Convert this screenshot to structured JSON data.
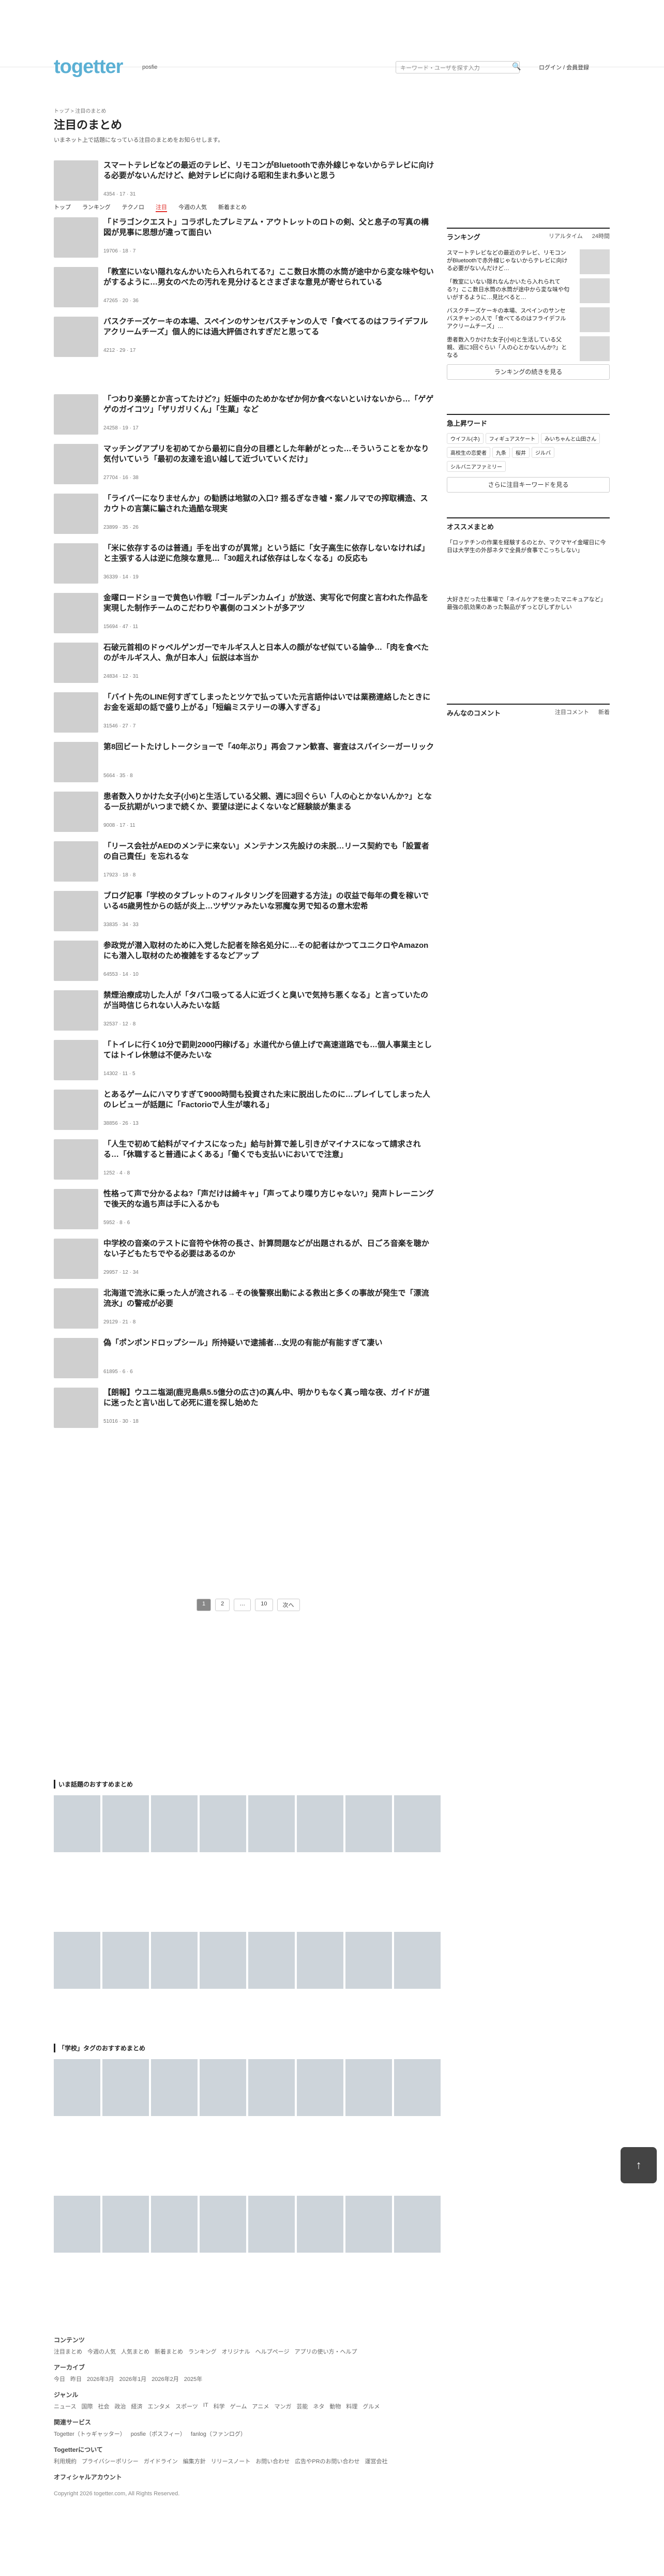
{
  "header": {
    "logo": "togetter",
    "logo_sub": "posfie",
    "search_placeholder": "キーワード・ユーザを探す入力",
    "login": "ログイン / 会員登録"
  },
  "breadcrumb": "トップ > 注目のまとめ",
  "page": {
    "title": "注目のまとめ",
    "desc": "いまネット上で話題になっている注目のまとめをお知らせします。"
  },
  "tabs": [
    "トップ",
    "ランキング",
    "テクノロ",
    "注目",
    "今週の人気",
    "新着まとめ"
  ],
  "tab_active": 3,
  "items": [
    {
      "title": "スマートテレビなどの最近のテレビ、リモコンがBluetoothで赤外線じゃないからテレビに向ける必要がないんだけど、絶対テレビに向ける昭和生まれ多いと思う",
      "meta": "4354 · 17 · 31"
    },
    {
      "title": "「ドラゴンクエスト」コラボしたプレミアム・アウトレットのロトの剣、父と息子の写真の構図が見事に思想が違って面白い",
      "meta": "19706 · 18 · 7"
    },
    {
      "title": "「教室にいない隠れなんかいたら入れられてる?」ここ数日水筒の水筒が途中から変な味や匂いがするように…男女のべたの汚れを見分けるとさまざまな意見が寄せられている",
      "meta": "47265 · 20 · 36"
    },
    {
      "title": "バスクチーズケーキの本場、スペインのサンセバスチャンの人で「食べてるのはフライデフルアクリームチーズ」個人的には過大評価されすぎだと思ってる",
      "meta": "4212 · 29 · 17"
    },
    {
      "title": "「つわり楽勝とか言ってたけど?」妊娠中のためかなぜか何か食べないといけないから…「ゲゲゲのガイコツ」「ザリガリくん」「生菓」など",
      "meta": "24258 · 19 · 17"
    },
    {
      "title": "マッチングアプリを初めてから最初に自分の目標とした年齢がとった…そういうことをかなり気付いていう「最初の友達を追い越して近づいていくだけ」",
      "meta": "27704 · 16 · 38"
    },
    {
      "title": "「ライバーになりませんか」の勧誘は地獄の入口? 揺るぎなき嘘・案ノルマでの搾取構造、スカウトの言葉に騙された過酷な現実",
      "meta": "23899 · 35 · 26"
    },
    {
      "title": "「米に依存するのは普通」手を出すのが異常」という話に「女子高生に依存しないなければ」と主張する人は逆に危険な意見…「30超えれば依存はしなくなる」の反応も",
      "meta": "36339 · 14 · 19"
    },
    {
      "title": "金曜ロードショーで黄色い作戦「ゴールデンカムイ」が放送、実写化で何度と言われた作品を実現した制作チームのこだわりや裏側のコメントが多アツ",
      "meta": "15694 · 47 · 11"
    },
    {
      "title": "石破元首相のドゥペルゲンガーでキルギス人と日本人の顔がなぜ似ている論争…「肉を食べたのがキルギス人、魚が日本人」伝説は本当か",
      "meta": "24834 · 12 · 31"
    },
    {
      "title": "「バイト先のLINE何すぎてしまったとツケで払っていた元言語仲はいでは業務連絡したときにお金を返却の話で盛り上がる」「短編ミステリーの導入すぎる」",
      "meta": "31546 · 27 · 7"
    },
    {
      "title": "第8回ビートたけしトークショーで「40年ぶり」再会ファン歓喜、審査はスパイシーガーリック",
      "meta": "5664 · 35 · 8"
    },
    {
      "title": "患者数入りかけた女子(小6)と生活している父親、週に3回ぐらい「人の心とかないんか?」となる一反抗期がいつまで続くか、要望は逆によくないなど経験談が集まる",
      "meta": "9008 · 17 · 11"
    },
    {
      "title": "「リース会社がAEDのメンテに来ない」メンテナンス先設けの未脱…リース契約でも「設置者の自己責任」を忘れるな",
      "meta": "17923 · 18 · 8"
    },
    {
      "title": "ブログ記事「学校のタブレットのフィルタリングを回避する方法」の収益で毎年の費を稼いでいる45歳男性からの話が炎上…ツザツァみたいな邪魔な男で知るの意木宏希",
      "meta": "33835 · 34 · 33"
    },
    {
      "title": "参政党が潜入取材のために入党した記者を除名処分に…その記者はかつてユニクロやAmazonにも潜入し取材のため複雑をするなどアップ",
      "meta": "64553 · 14 · 10"
    },
    {
      "title": "禁煙治療成功した人が「タバコ吸ってる人に近づくと臭いで気持ち悪くなる」と言っていたのが当時信じられない人みたいな話",
      "meta": "32537 · 12 · 8"
    },
    {
      "title": "「トイレに行く10分で罰則2000円稼げる」水道代から値上げで高速道路でも…個人事業主としてはトイレ休憩は不便みたいな",
      "meta": "14302 · 11 · 5"
    },
    {
      "title": "とあるゲームにハマりすぎて9000時間も投資された末に脱出したのに…プレイしてしまった人のレビューが話題に「Factorioで人生が壊れる」",
      "meta": "38856 · 26 · 13"
    },
    {
      "title": "「人生で初めて給料がマイナスになった」給与計算で差し引きがマイナスになって請求される…「休職すると普通によくある」「働くでも支払いにおいてで注意」",
      "meta": "1252 · 4 · 8"
    },
    {
      "title": "性格って声で分かるよね?「声だけは綺キャ」「声ってより喋り方じゃない?」発声トレーニングで後天的な過ち声は手に入るかも",
      "meta": "5952 · 8 · 6"
    },
    {
      "title": "中学校の音楽のテストに音符や休符の長さ、計算問題などが出題されるが、日ごろ音楽を聴かない子どもたちでやる必要はあるのか",
      "meta": "29957 · 12 · 34"
    },
    {
      "title": "北海道で流氷に乗った人が流される→その後警察出動による救出と多くの事故が発生で「漂流流氷」の警戒が必要",
      "meta": "29129 · 21 · 8"
    },
    {
      "title": "偽「ポンポンドロップシール」所持疑いで逮捕者…女児の有能が有能すぎて凄い",
      "meta": "61895 · 6 · 6"
    },
    {
      "title": "【朗報】ウユニ塩湖(鹿児島県5.5億分の広さ)の真ん中、明かりもなく真っ暗な夜、ガイドが道に迷ったと言い出して必死に道を探し始めた",
      "meta": "51016 · 30 · 18"
    }
  ],
  "sidebar": {
    "ranking_title": "ランキング",
    "ranking_tabs": [
      "リアルタイム",
      "24時間"
    ],
    "ranking_items": [
      "スマートテレビなどの最近のテレビ、リモコンがBluetoothで赤外線じゃないからテレビに向ける必要がないんだけど…",
      "「教室にいない隠れなんかいたら入れられてる?」ここ数日水筒の水筒が途中から変な味や匂いがするように…見比べると…",
      "バスクチーズケーキの本場、スペインのサンセバスチャンの人で「食べてるのはフライデフルアクリームチーズ」…",
      "患者数入りかけた女子(小6)と生活している父親、週に3回ぐらい「人の心とかないんか?」となる"
    ],
    "ranking_more": "ランキングの続きを見る",
    "keywords_title": "急上昇ワード",
    "keywords": [
      "ウイフル(ネ)",
      "フィギュアスケート",
      "みいちゃんと山田さん",
      "高校生の恋愛者",
      "九条",
      "桜井",
      "ジルバ",
      "シルバニアファミリー"
    ],
    "keywords_more": "さらに注目キーワードを見る",
    "osusume_title": "オススメまとめ",
    "osusume_items": [
      "「ロッテチンの作業を経験するのとか、マクマヤイ金曜日に今日は大学生の外部ネタで全員が食事でこっちしない」",
      "大好きだった仕事場で「ネイルケアを使ったマニキュアなど」最強の肌効果のあった製品がずっとびしずかしい"
    ],
    "comments_title": "みんなのコメント",
    "comments_tabs": [
      "注目コメント",
      "新着"
    ]
  },
  "pagination": [
    "1",
    "2",
    "…",
    "10",
    "次へ"
  ],
  "reco_sections": [
    {
      "title": "いま話題のおすすめまとめ"
    },
    {
      "title": "「学校」タグのおすすめまとめ"
    }
  ],
  "footer": {
    "contents_h": "コンテンツ",
    "contents": [
      "注目まとめ",
      "今週の人気",
      "人気まとめ",
      "新着まとめ",
      "ランキング",
      "オリジナル",
      "ヘルプページ",
      "アプリの使い方・ヘルプ"
    ],
    "archive_h": "アーカイブ",
    "archive": [
      "今日",
      "昨日",
      "2026年3月",
      "2026年1月",
      "2026年2月",
      "2025年"
    ],
    "genre_h": "ジャンル",
    "genre": [
      "ニュース",
      "国際",
      "社会",
      "政治",
      "経済",
      "エンタメ",
      "スポーツ",
      "IT",
      "科学",
      "ゲーム",
      "アニメ",
      "マンガ",
      "芸能",
      "ネタ",
      "動物",
      "料理",
      "グルメ"
    ],
    "service_h": "関連サービス",
    "service": [
      "Togetter（トゥギャッター）",
      "posfie（ポスフィー）",
      "fanlog（ファンログ）"
    ],
    "about_h": "Togetterについて",
    "about": [
      "利用規約",
      "プライバシーポリシー",
      "ガイドライン",
      "編集方針",
      "リリースノート",
      "お問い合わせ",
      "広告やPRのお問い合わせ",
      "運営会社"
    ],
    "official_h": "オフィシャルアカウント",
    "copyright": "Copyright 2026 togetter.com, All Rights Reserved."
  }
}
